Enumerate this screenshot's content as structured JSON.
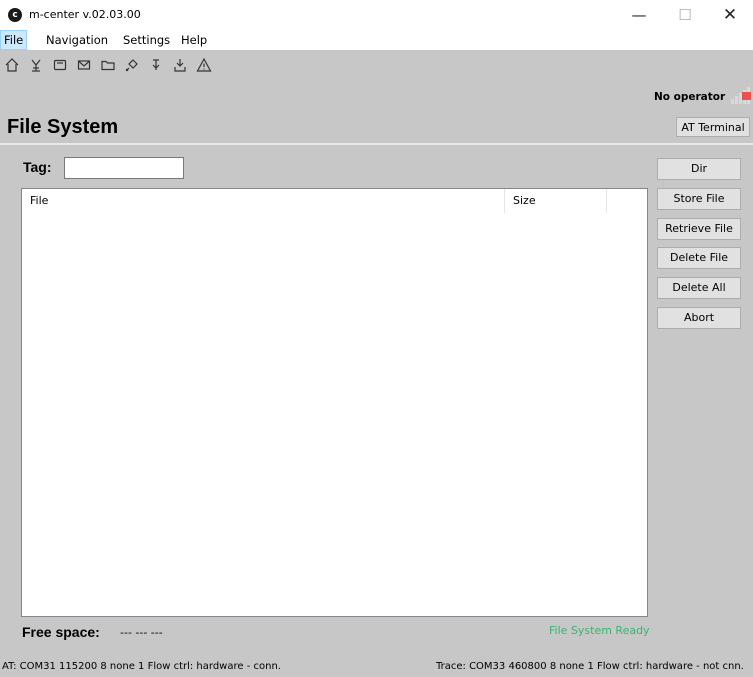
{
  "window": {
    "title": "m-center v.02.03.00",
    "app_icon_glyph": "c"
  },
  "window_controls": {
    "minimize": "—",
    "maximize": "☐",
    "close": "✕"
  },
  "menu": {
    "items": [
      "File",
      "Navigation",
      "Settings",
      "Help"
    ]
  },
  "toolbar": {
    "icons": [
      "home-icon",
      "antenna-icon",
      "sim-card-icon",
      "message-icon",
      "folder-icon",
      "satellite-icon",
      "tower-icon",
      "download-icon",
      "warning-icon"
    ]
  },
  "operator": {
    "text": "No operator",
    "signal": "none",
    "signal_color": "#e8534f"
  },
  "page": {
    "title": "File System",
    "at_terminal_label": "AT Terminal"
  },
  "tag": {
    "label": "Tag:",
    "value": ""
  },
  "file_table": {
    "columns": [
      "File",
      "Size",
      ""
    ],
    "rows": []
  },
  "actions": {
    "buttons": [
      "Dir",
      "Store File",
      "Retrieve File",
      "Delete File",
      "Delete All",
      "Abort"
    ]
  },
  "footer": {
    "free_space_label": "Free space:",
    "free_space_value": "--- --- ---",
    "fs_status": "File System Ready",
    "fs_status_color": "#3cb371"
  },
  "statusbar": {
    "at": "AT: COM31 115200 8 none 1 Flow ctrl: hardware - conn.",
    "trace": "Trace: COM33 460800 8 none 1 Flow ctrl: hardware - not cnn."
  }
}
